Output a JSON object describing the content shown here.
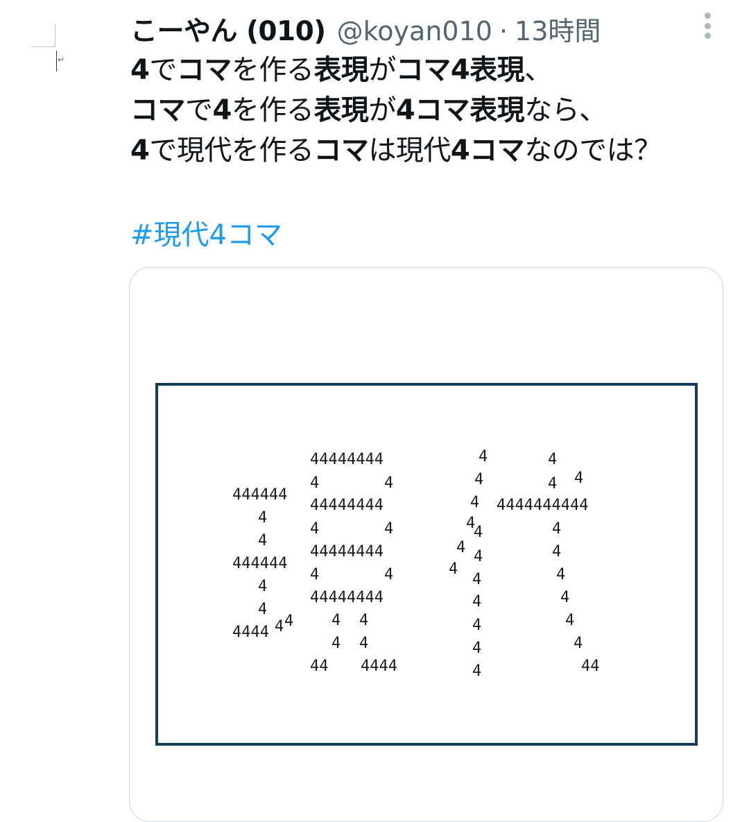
{
  "tweet": {
    "author_name": "こーやん (010)",
    "handle": "@koyan010",
    "separator": "·",
    "time": "13時間",
    "lines": [
      [
        [
          "4",
          true
        ],
        [
          "で",
          false
        ],
        [
          "コマ",
          true
        ],
        [
          "を作る",
          false
        ],
        [
          "表現",
          true
        ],
        [
          "が",
          false
        ],
        [
          "コマ4表現",
          true
        ],
        [
          "、",
          false
        ]
      ],
      [
        [
          "コマ",
          true
        ],
        [
          "で",
          false
        ],
        [
          "4",
          true
        ],
        [
          "を作る",
          false
        ],
        [
          "表現",
          true
        ],
        [
          "が",
          false
        ],
        [
          "4コマ表現",
          true
        ],
        [
          "なら、",
          false
        ]
      ],
      [
        [
          "4",
          true
        ],
        [
          "で現代を作る",
          false
        ],
        [
          "コマ",
          true
        ],
        [
          "は現代",
          false
        ],
        [
          "4コマ",
          true
        ],
        [
          "なのでは？",
          false
        ]
      ]
    ],
    "hashtag": "#現代4コマ"
  },
  "image_art": [
    [
      "4",
      690,
      648
    ],
    [
      "4",
      790,
      652
    ],
    [
      "44444444",
      447,
      652
    ],
    [
      "4",
      684,
      681
    ],
    [
      "4",
      790,
      687
    ],
    [
      "4",
      828,
      679
    ],
    [
      "444444",
      335,
      703
    ],
    [
      "4",
      447,
      686
    ],
    [
      "4",
      554,
      686
    ],
    [
      "44444444",
      447,
      718
    ],
    [
      "4",
      678,
      714
    ],
    [
      "4444444444",
      716,
      718
    ],
    [
      "4",
      372,
      736
    ],
    [
      "4",
      447,
      752
    ],
    [
      "4",
      554,
      752
    ],
    [
      "4",
      672,
      744
    ],
    [
      "4",
      683,
      757
    ],
    [
      "4",
      796,
      752
    ],
    [
      "4",
      372,
      769
    ],
    [
      "44444444",
      447,
      785
    ],
    [
      "4",
      658,
      779
    ],
    [
      "4",
      683,
      792
    ],
    [
      "4",
      796,
      785
    ],
    [
      "444444",
      335,
      802
    ],
    [
      "4",
      447,
      818
    ],
    [
      "4",
      554,
      818
    ],
    [
      "4",
      647,
      810
    ],
    [
      "4",
      681,
      825
    ],
    [
      "4",
      802,
      818
    ],
    [
      "4",
      372,
      835
    ],
    [
      "44444444",
      447,
      851
    ],
    [
      "4",
      681,
      857
    ],
    [
      "4",
      808,
      851
    ],
    [
      "4",
      372,
      868
    ],
    [
      "4",
      478,
      884
    ],
    [
      "4",
      518,
      884
    ],
    [
      "4",
      681,
      891
    ],
    [
      "4",
      815,
      884
    ],
    [
      "4444",
      335,
      901
    ],
    [
      "4",
      396,
      893
    ],
    [
      "4",
      410,
      885
    ],
    [
      "4",
      478,
      917
    ],
    [
      "4",
      518,
      917
    ],
    [
      "4",
      681,
      924
    ],
    [
      "4",
      827,
      917
    ],
    [
      "44",
      447,
      950
    ],
    [
      "4444",
      520,
      950
    ],
    [
      "4",
      681,
      957
    ],
    [
      "44",
      838,
      950
    ]
  ]
}
